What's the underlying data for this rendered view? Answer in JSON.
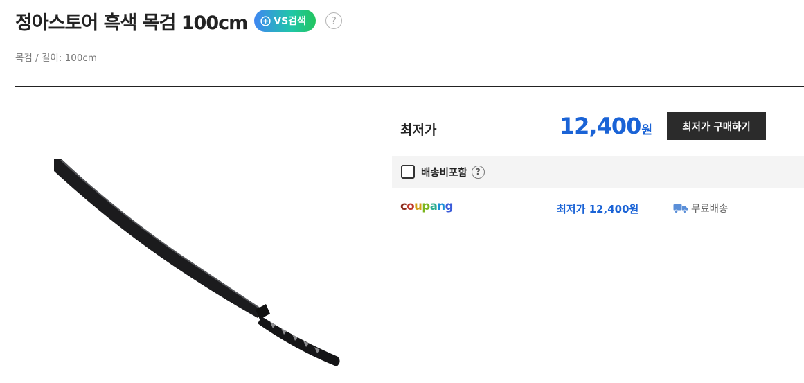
{
  "header": {
    "title": "정아스토어 흑색 목검 100cm",
    "vs_search_label": "VS검색",
    "help_glyph": "?",
    "subtitle": "목검 / 길이: 100cm"
  },
  "product_image": {
    "alt": "black wooden sword"
  },
  "lowest_price": {
    "label": "최저가",
    "amount": "12,400",
    "unit": "원",
    "buy_button_label": "최저가 구매하기"
  },
  "shipping_filter": {
    "label": "배송비포함",
    "checked": false,
    "help_glyph": "?"
  },
  "sellers": [
    {
      "logo_letters": [
        "c",
        "o",
        "u",
        "p",
        "a",
        "n",
        "g"
      ],
      "logo_colors": [
        "#8a2d1c",
        "#c0392b",
        "#d4a017",
        "#7ab51d",
        "#2eae8e",
        "#1a8fd6",
        "#3a5bd9"
      ],
      "price_label": "최저가 12,400원",
      "delivery_label": "무료배송",
      "delivery_icon": "truck-icon"
    }
  ],
  "colors": {
    "price_blue": "#1a63d6",
    "button_dark": "#2b2b2b"
  }
}
